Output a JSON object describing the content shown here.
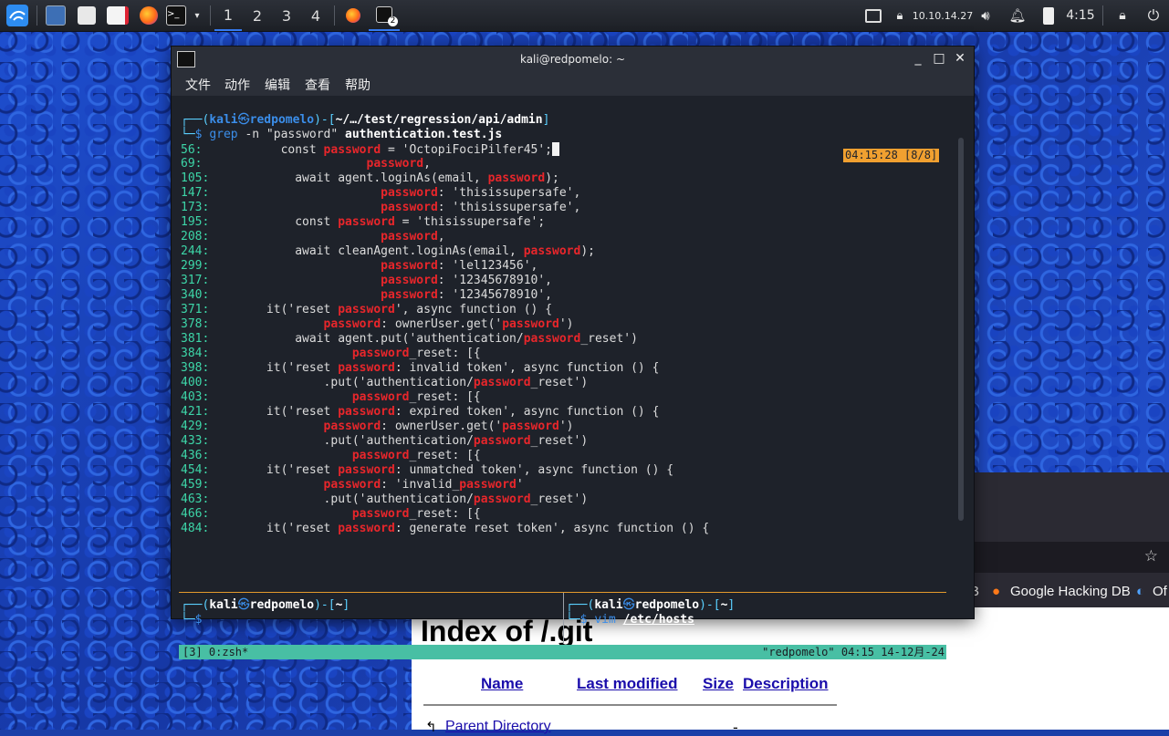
{
  "taskbar": {
    "workspaces": [
      "1",
      "2",
      "3",
      "4"
    ],
    "active_workspace": "1",
    "terminal_badge": "2",
    "ip": "10.10.14.27",
    "time": "4:15"
  },
  "browser": {
    "bookmarks": [
      "Google Hacking DB",
      "Of"
    ],
    "bookmark_partial": "B",
    "page_title": "Index of /.git",
    "columns": [
      "Name",
      "Last modified",
      "Size",
      "Description"
    ],
    "parent_link": "Parent Directory",
    "parent_size": "-"
  },
  "terminal": {
    "title": "kali@redpomelo: ~",
    "menu": [
      "文件",
      "动作",
      "编辑",
      "查看",
      "帮助"
    ],
    "clock_badge": "04:15:28 [8/8]",
    "prompt_user": "kali",
    "prompt_at": "㉿",
    "prompt_host": "redpomelo",
    "prompt_path": "~/…/test/regression/api/admin",
    "command_grep": "grep",
    "command_args": "-n \"password\"",
    "command_file": "authentication.test.js",
    "lines": [
      {
        "n": "56:",
        "pre": "           const ",
        "hl": "password",
        "post": " = 'OctopiFociPilfer45';"
      },
      {
        "n": "69:",
        "pre": "                       ",
        "hl": "password",
        "post": ","
      },
      {
        "n": "105:",
        "pre": "            await agent.loginAs(email, ",
        "hl": "password",
        "post": ");"
      },
      {
        "n": "147:",
        "pre": "                        ",
        "hl": "password",
        "post": ": 'thisissupersafe',"
      },
      {
        "n": "173:",
        "pre": "                        ",
        "hl": "password",
        "post": ": 'thisissupersafe',"
      },
      {
        "n": "195:",
        "pre": "            const ",
        "hl": "password",
        "post": " = 'thisissupersafe';"
      },
      {
        "n": "208:",
        "pre": "                        ",
        "hl": "password",
        "post": ","
      },
      {
        "n": "244:",
        "pre": "            await cleanAgent.loginAs(email, ",
        "hl": "password",
        "post": ");"
      },
      {
        "n": "299:",
        "pre": "                        ",
        "hl": "password",
        "post": ": 'lel123456',"
      },
      {
        "n": "317:",
        "pre": "                        ",
        "hl": "password",
        "post": ": '12345678910',"
      },
      {
        "n": "340:",
        "pre": "                        ",
        "hl": "password",
        "post": ": '12345678910',"
      },
      {
        "n": "371:",
        "pre": "        it('reset ",
        "hl": "password",
        "post": "', async function () {"
      },
      {
        "n": "378:",
        "pre": "                ",
        "hl": "password",
        "post": ": ownerUser.get('",
        "hl2": "password",
        "post2": "')"
      },
      {
        "n": "381:",
        "pre": "            await agent.put('authentication/",
        "hl": "password",
        "post": "_reset')"
      },
      {
        "n": "384:",
        "pre": "                    ",
        "hl": "password",
        "post": "_reset: [{"
      },
      {
        "n": "398:",
        "pre": "        it('reset ",
        "hl": "password",
        "post": ": invalid token', async function () {"
      },
      {
        "n": "400:",
        "pre": "                .put('authentication/",
        "hl": "password",
        "post": "_reset')"
      },
      {
        "n": "403:",
        "pre": "                    ",
        "hl": "password",
        "post": "_reset: [{"
      },
      {
        "n": "421:",
        "pre": "        it('reset ",
        "hl": "password",
        "post": ": expired token', async function () {"
      },
      {
        "n": "429:",
        "pre": "                ",
        "hl": "password",
        "post": ": ownerUser.get('",
        "hl2": "password",
        "post2": "')"
      },
      {
        "n": "433:",
        "pre": "                .put('authentication/",
        "hl": "password",
        "post": "_reset')"
      },
      {
        "n": "436:",
        "pre": "                    ",
        "hl": "password",
        "post": "_reset: [{"
      },
      {
        "n": "454:",
        "pre": "        it('reset ",
        "hl": "password",
        "post": ": unmatched token', async function () {"
      },
      {
        "n": "459:",
        "pre": "                ",
        "hl": "password",
        "post": ": 'invalid_",
        "hl2": "password",
        "post2": "'"
      },
      {
        "n": "463:",
        "pre": "                .put('authentication/",
        "hl": "password",
        "post": "_reset')"
      },
      {
        "n": "466:",
        "pre": "                    ",
        "hl": "password",
        "post": "_reset: [{"
      },
      {
        "n": "484:",
        "pre": "        it('reset ",
        "hl": "password",
        "post": ": generate reset token', async function () {"
      }
    ],
    "pane_left_path": "~",
    "pane_right_path": "~",
    "pane_right_cmd": "vim",
    "pane_right_arg": "/etc/hosts",
    "status_left": "[3] 0:zsh*",
    "status_right": "\"redpomelo\" 04:15 14-12月-24"
  }
}
